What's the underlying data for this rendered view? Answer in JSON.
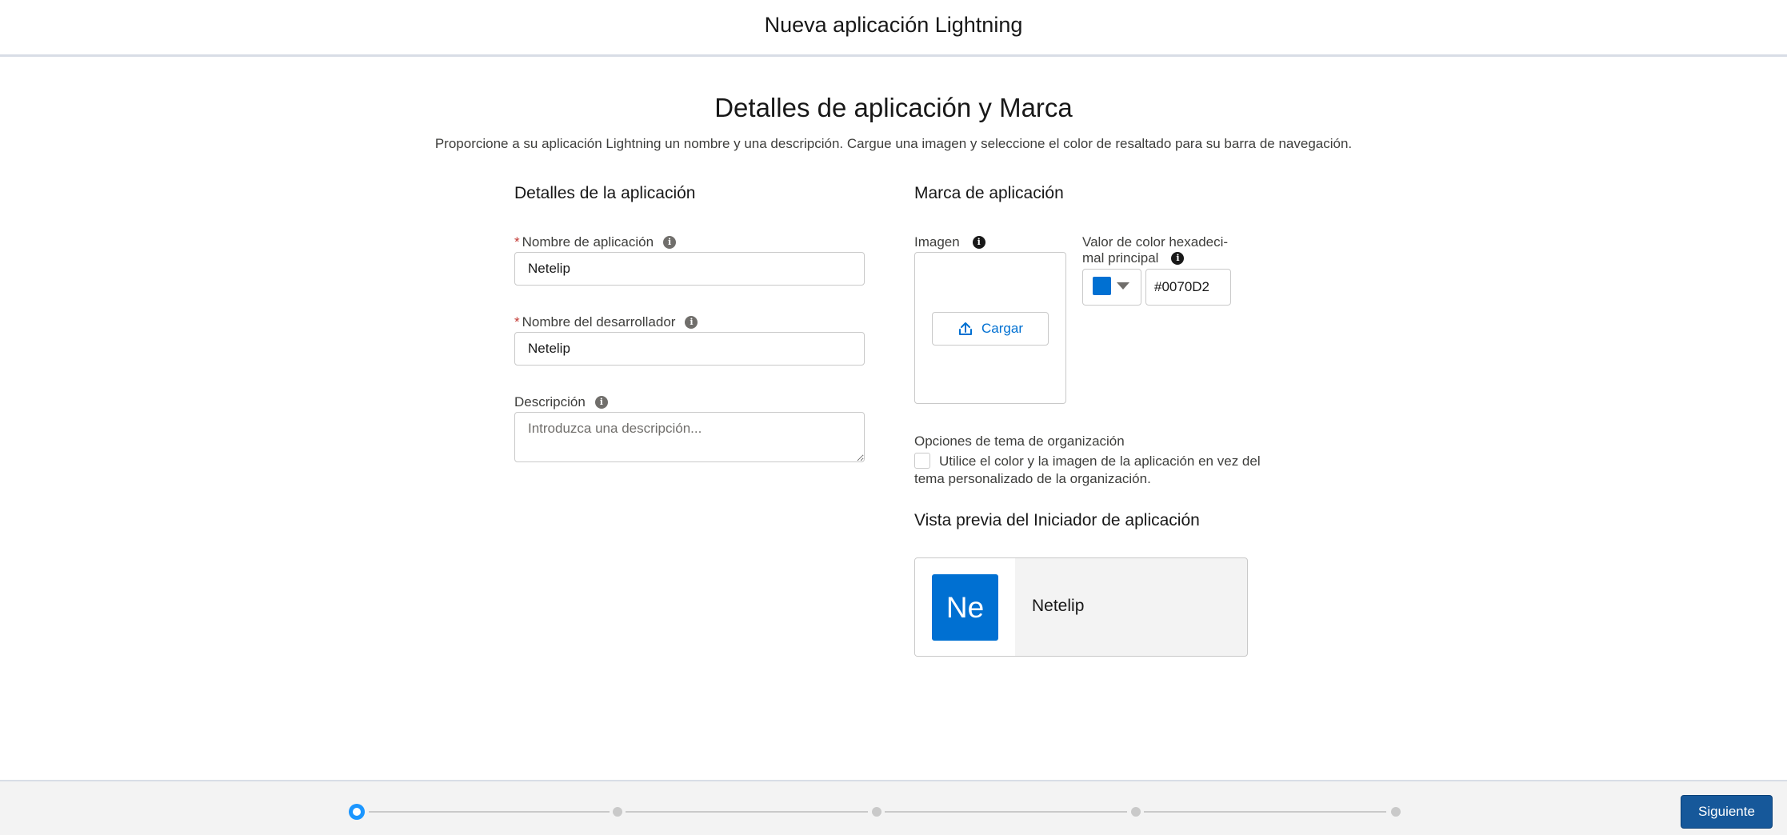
{
  "header": {
    "title": "Nueva aplicación Lightning"
  },
  "page": {
    "title": "Detalles de aplicación y Marca",
    "subtitle": "Proporcione a su aplicación Lightning un nombre y una descripción. Cargue una imagen y seleccione el color de resaltado para su barra de navegación."
  },
  "details": {
    "heading": "Detalles de la aplicación",
    "app_name": {
      "label": "Nombre de aplicación",
      "value": "Netelip",
      "required": "*"
    },
    "developer_name": {
      "label": "Nombre del desarrollador",
      "value": "Netelip",
      "required": "*"
    },
    "description": {
      "label": "Descripción",
      "placeholder": "Introduzca una descripción...",
      "value": ""
    }
  },
  "branding": {
    "heading": "Marca de aplicación",
    "image_label": "Imagen",
    "upload_label": "Cargar",
    "color_label_line1": "Valor de color hexadeci-",
    "color_label_line2": "mal principal",
    "color_value": "#0070D2",
    "swatch_color": "#0070d2",
    "theme_options_label": "Opciones de tema de organización",
    "theme_checkbox_text": "Utilice el color y la imagen de la aplicación en vez del tema personalizado de la organización.",
    "theme_checked": false
  },
  "preview": {
    "heading": "Vista previa del Iniciador de aplicación",
    "initials": "Ne",
    "name": "Netelip"
  },
  "footer": {
    "next_label": "Siguiente",
    "current_step": 1,
    "total_steps": 5
  },
  "icons": {
    "info": "info-icon",
    "upload": "upload-icon",
    "caret": "chevron-down-icon"
  },
  "colors": {
    "brand_blue": "#0070d2",
    "next_button": "#16589a",
    "active_step": "#1b96ff",
    "required": "#c23934"
  }
}
